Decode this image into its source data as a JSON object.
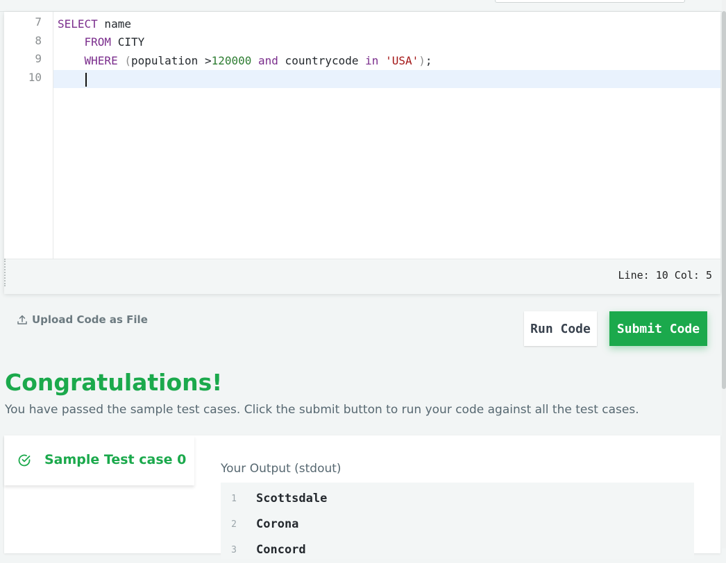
{
  "editor": {
    "line_numbers": [
      "7",
      "8",
      "9",
      "10"
    ],
    "code": {
      "l7": {
        "kw1": "SELECT",
        "rest": " name"
      },
      "l8": {
        "indent": "    ",
        "kw1": "FROM",
        "rest": " CITY"
      },
      "l9": {
        "indent": "    ",
        "kw1": "WHERE",
        "sp": " ",
        "paren_open": "(",
        "ident1": "population",
        "op": " >",
        "num": "120000",
        "sp2": " ",
        "kw2": "and",
        "ident2": " countrycode ",
        "kw3": "in",
        "sp3": " ",
        "str": "'USA'",
        "paren_close": ")",
        "semi": ";"
      }
    },
    "status": "Line: 10 Col: 5"
  },
  "actions": {
    "upload_label": "Upload Code as File",
    "run_label": "Run Code",
    "submit_label": "Submit Code"
  },
  "result": {
    "title": "Congratulations!",
    "message": "You have passed the sample test cases. Click the submit button to run your code against all the test cases.",
    "test_case_label": "Sample Test case 0",
    "output_label": "Your Output (stdout)",
    "output_lines": [
      {
        "n": "1",
        "text": "Scottsdale"
      },
      {
        "n": "2",
        "text": "Corona"
      },
      {
        "n": "3",
        "text": "Concord"
      }
    ]
  },
  "colors": {
    "accent_green": "#1ba94c",
    "keyword": "#7a2d8c",
    "number": "#2e7d32",
    "string": "#a31515"
  },
  "icons": {
    "upload": "upload-icon",
    "check": "check-circle-icon"
  }
}
